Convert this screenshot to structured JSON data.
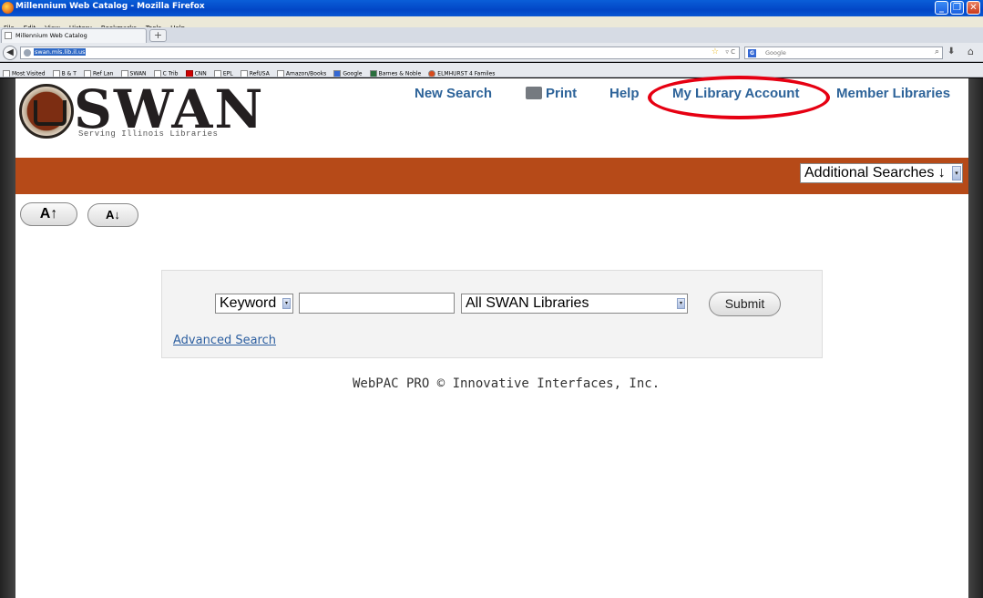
{
  "window": {
    "title": "Millennium Web Catalog - Mozilla Firefox",
    "buttons": [
      "_",
      "❐",
      "✕"
    ]
  },
  "menubar": [
    "File",
    "Edit",
    "View",
    "History",
    "Bookmarks",
    "Tools",
    "Help"
  ],
  "tabs": [
    {
      "label": "Millennium Web Catalog"
    }
  ],
  "newtab_label": "+",
  "navbar": {
    "url": "swan.mls.lib.il.us",
    "search_placeholder": "Google",
    "search_engine_icon": "G"
  },
  "bookmarks": [
    "Most Visited",
    "B & T",
    "Ref Lan",
    "SWAN",
    "C Trib",
    "CNN",
    "EPL",
    "RefUSA",
    "Amazon/Books",
    "Google",
    "Barnes & Noble",
    "ELMHURST 4 Familes"
  ],
  "site": {
    "brand": "SWAN",
    "tagline": "Serving Illinois Libraries",
    "nav": {
      "new_search": "New Search",
      "print": "Print",
      "help": "Help",
      "my_account": "My Library Account",
      "member_libraries": "Member Libraries"
    },
    "additional_searches": "Additional Searches ↓",
    "font_up": "A↑",
    "font_down": "A↓",
    "search": {
      "type_selected": "Keyword",
      "keyword_value": "",
      "scope_selected": "All SWAN Libraries",
      "submit": "Submit",
      "advanced": "Advanced Search"
    },
    "footer": "WebPAC PRO © Innovative Interfaces, Inc."
  },
  "colors": {
    "accent_bar": "#b64a18",
    "nav_link": "#2d6399",
    "highlight": "#e60012"
  }
}
